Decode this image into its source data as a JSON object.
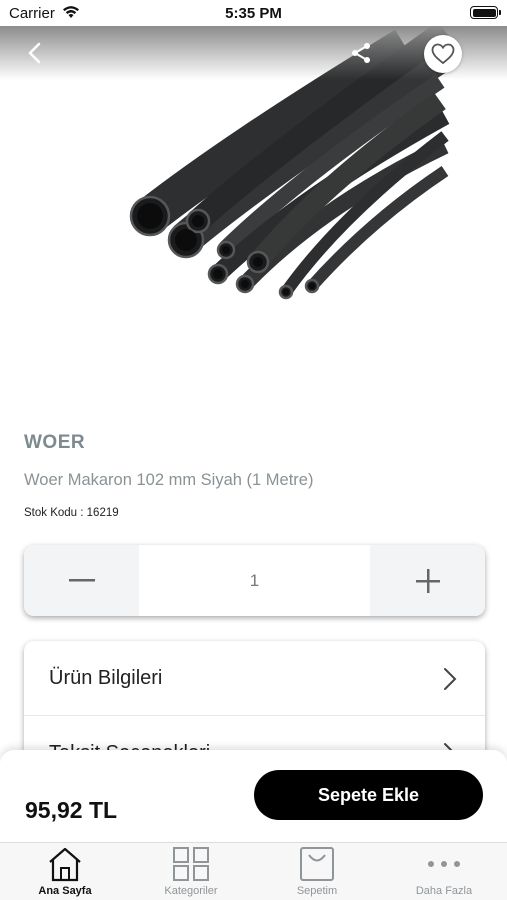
{
  "status_bar": {
    "carrier": "Carrier",
    "time": "5:35 PM"
  },
  "header": {
    "icons": [
      "back-arrow-icon",
      "share-icon",
      "heart-icon"
    ]
  },
  "product": {
    "brand": "WOER",
    "name": "Woer Makaron 102 mm Siyah (1 Metre)",
    "stock_code": "Stok Kodu : 16219"
  },
  "quantity": {
    "value": "1",
    "icons": [
      "minus-icon",
      "plus-icon"
    ]
  },
  "info_rows": [
    {
      "label": "Ürün Bilgileri"
    },
    {
      "label": "Taksit Seçenekleri"
    }
  ],
  "footer": {
    "price": "95,92 TL",
    "add_to_cart": "Sepete Ekle"
  },
  "tab_bar": [
    {
      "label": "Ana Sayfa",
      "icon": "home-icon",
      "active": true
    },
    {
      "label": "Kategoriler",
      "icon": "grid-icon",
      "active": false
    },
    {
      "label": "Sepetim",
      "icon": "basket-icon",
      "active": false
    },
    {
      "label": "Daha Fazla",
      "icon": "more-icon",
      "active": false
    }
  ],
  "colors": {
    "brand_text": "#7d8a8f",
    "button": "#000000",
    "tab_inactive": "#8e969a"
  }
}
